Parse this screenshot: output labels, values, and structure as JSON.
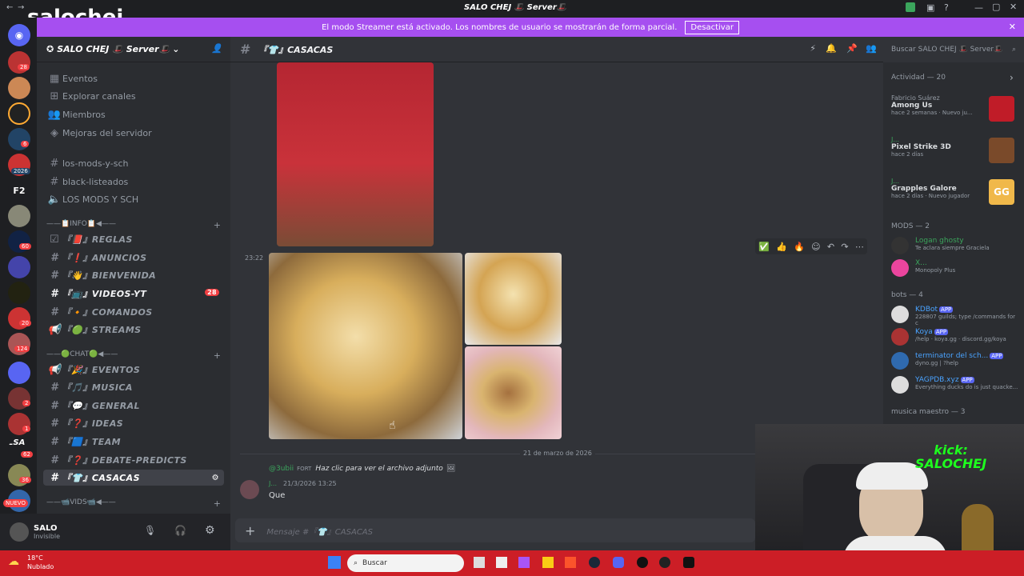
{
  "app": {
    "logo_text": "salochej",
    "window_title": "SALO CHEJ 🎩 Server🎩"
  },
  "streamer_bar": {
    "message": "El modo Streamer está activado. Los nombres de usuario se mostrarán de forma parcial.",
    "button": "Desactivar"
  },
  "server_badges": [
    "28",
    "6",
    "2026",
    "60",
    "20",
    "124",
    "2",
    "1",
    "62",
    "36"
  ],
  "server": {
    "name": "SALO CHEJ 🎩 Server🎩",
    "top_items": [
      "Eventos",
      "Explorar canales",
      "Miembros",
      "Mejoras del servidor"
    ],
    "channels_plain": [
      "los-mods-y-sch",
      "black-listeados",
      "LOS MODS Y SCH"
    ],
    "cat_info": "——📋INFO📋◀——",
    "info_channels": [
      {
        "label": "『📕』REGLAS"
      },
      {
        "label": "『❗』ANUNCIOS"
      },
      {
        "label": "『👋』BIENVENIDA"
      },
      {
        "label": "『📺』VIDEOS-YT",
        "badge": "28"
      },
      {
        "label": "『🔸』COMANDOS"
      },
      {
        "label": "『🟢』STREAMS"
      }
    ],
    "cat_chat": "——🟢CHAT🟢◀——",
    "chat_channels": [
      {
        "label": "『🎉』EVENTOS"
      },
      {
        "label": "『🎵』MUSICA"
      },
      {
        "label": "『💬』GENERAL"
      },
      {
        "label": "『❓』IDEAS"
      },
      {
        "label": "『🟦』TEAM"
      },
      {
        "label": "『❓』DEBATE-PREDICTS"
      },
      {
        "label": "『👕』CASACAS"
      }
    ],
    "cat_vids": "——📹VIDS📹◀——"
  },
  "user": {
    "name": "SALO",
    "status": "Invisible"
  },
  "channel": {
    "name": "『👕』CASACAS"
  },
  "search": {
    "placeholder": "Buscar SALO CHEJ 🎩 Server🎩"
  },
  "messages": {
    "time": "23:22",
    "date_divider": "21 de marzo de 2026",
    "reply_author": "@3ubii",
    "reply_tag": "FORT",
    "reply_text": "Haz clic para ver el archivo adjunto",
    "author": "J...",
    "timestamp": "21/3/2026 13:25",
    "text": "Que"
  },
  "composer": {
    "placeholder": "Mensaje #『👕』CASACAS"
  },
  "members": {
    "activity_header": "Actividad — 20",
    "activities": [
      {
        "user": "Fabricio Suárez",
        "game": "Among Us",
        "sub": "hace 2 semanas · Nuevo ju..."
      },
      {
        "user": "J...",
        "game": "Pixel Strike 3D",
        "sub": "hace 2 días"
      },
      {
        "user": "J...",
        "game": "Grapples Galore",
        "sub": "hace 2 días · Nuevo jugador"
      }
    ],
    "mods_header": "MODS — 2",
    "mods": [
      {
        "name": "Logan ghosty",
        "sub": "Te aclara siempre Graciela"
      },
      {
        "name": "X...",
        "sub": "Monopoly Plus"
      }
    ],
    "bots_header": "bots — 4",
    "bots": [
      {
        "name": "KDBot",
        "sub": "228807 guilds; type /commands for c"
      },
      {
        "name": "Koya",
        "sub": "/help · koya.gg · discord.gg/koya"
      },
      {
        "name": "terminator del sch...",
        "sub": "dyno.gg | ?help"
      },
      {
        "name": "YAGPDB.xyz",
        "sub": "Everything ducks do is just quacke..."
      }
    ],
    "app_label": "APP",
    "music_header": "musica maestro — 3"
  },
  "webcam": {
    "overlay_line1": "kick:",
    "overlay_line2": "SALOCHEJ"
  },
  "taskbar": {
    "temp": "18°C",
    "weather": "Nublado",
    "search": "Buscar"
  },
  "colors": {
    "streamer": "#a64ff0",
    "taskbar": "#cc1e26",
    "mention": "#f23f42"
  }
}
